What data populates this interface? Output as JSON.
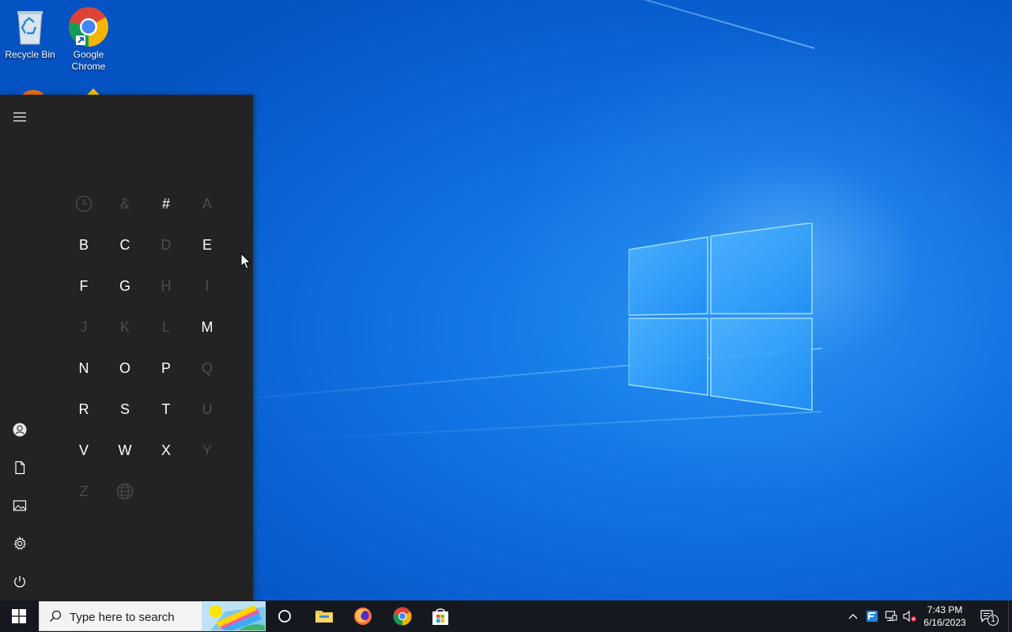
{
  "desktop": {
    "icons": [
      {
        "label": "Recycle Bin",
        "icon": "recycle-bin-icon"
      },
      {
        "label": "Google Chrome",
        "icon": "chrome-icon"
      }
    ]
  },
  "start_menu": {
    "rail": [
      "hamburger-menu-icon",
      "user-account-icon",
      "documents-icon",
      "pictures-icon",
      "settings-gear-icon",
      "power-icon"
    ],
    "jump_list": [
      {
        "label": "",
        "icon": "clock-recent-icon",
        "enabled": false
      },
      {
        "label": "&",
        "enabled": false
      },
      {
        "label": "#",
        "enabled": true
      },
      {
        "label": "A",
        "enabled": false
      },
      {
        "label": "B",
        "enabled": true
      },
      {
        "label": "C",
        "enabled": true
      },
      {
        "label": "D",
        "enabled": false
      },
      {
        "label": "E",
        "enabled": true
      },
      {
        "label": "F",
        "enabled": true
      },
      {
        "label": "G",
        "enabled": true
      },
      {
        "label": "H",
        "enabled": false
      },
      {
        "label": "I",
        "enabled": false
      },
      {
        "label": "J",
        "enabled": false
      },
      {
        "label": "K",
        "enabled": false
      },
      {
        "label": "L",
        "enabled": false
      },
      {
        "label": "M",
        "enabled": true
      },
      {
        "label": "N",
        "enabled": true
      },
      {
        "label": "O",
        "enabled": true
      },
      {
        "label": "P",
        "enabled": true
      },
      {
        "label": "Q",
        "enabled": false
      },
      {
        "label": "R",
        "enabled": true
      },
      {
        "label": "S",
        "enabled": true
      },
      {
        "label": "T",
        "enabled": true
      },
      {
        "label": "U",
        "enabled": false
      },
      {
        "label": "V",
        "enabled": true
      },
      {
        "label": "W",
        "enabled": true
      },
      {
        "label": "X",
        "enabled": true
      },
      {
        "label": "Y",
        "enabled": false
      },
      {
        "label": "Z",
        "enabled": false
      },
      {
        "label": "",
        "icon": "globe-icon",
        "enabled": false
      }
    ]
  },
  "taskbar": {
    "search_placeholder": "Type here to search",
    "pinned": [
      "cortana-icon",
      "file-explorer-icon",
      "firefox-icon",
      "chrome-icon",
      "microsoft-store-icon"
    ],
    "tray_icons": [
      "show-hidden-icons-chevron-icon",
      "app-tray-icon",
      "network-icon",
      "volume-muted-icon"
    ],
    "clock": {
      "time": "7:43 PM",
      "date": "6/16/2023"
    },
    "notification_count": "1"
  },
  "colors": {
    "start_bg": "#232323",
    "taskbar_bg": "#15191f",
    "disabled_letter": "#4d4d4d"
  }
}
